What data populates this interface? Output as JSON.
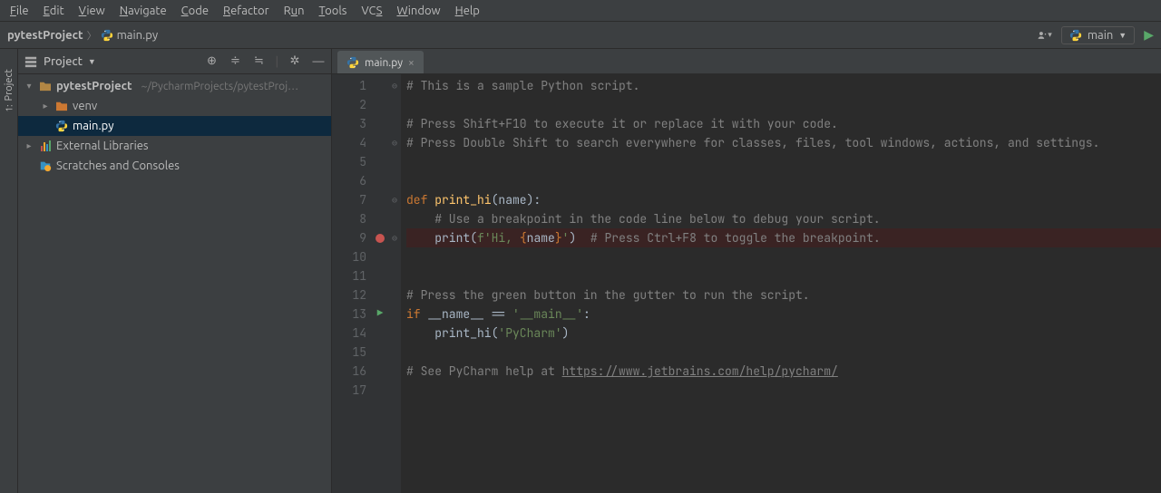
{
  "menu": {
    "file": "File",
    "edit": "Edit",
    "view": "View",
    "navigate": "Navigate",
    "code": "Code",
    "refactor": "Refactor",
    "run": "Run",
    "tools": "Tools",
    "vcs": "VCS",
    "window": "Window",
    "help": "Help"
  },
  "breadcrumb": {
    "project": "pytestProject",
    "file": "main.py"
  },
  "runConfig": {
    "label": "main"
  },
  "projectPanel": {
    "title": "Project",
    "root": {
      "name": "pytestProject",
      "path": "~/PycharmProjects/pytestProj…"
    },
    "venv": "venv",
    "mainFile": "main.py",
    "extLibs": "External Libraries",
    "scratches": "Scratches and Consoles"
  },
  "tab": {
    "label": "main.py"
  },
  "sideTab": {
    "label": "Project"
  },
  "code": {
    "lines": [
      "# This is a sample Python script.",
      "",
      "# Press Shift+F10 to execute it or replace it with your code.",
      "# Press Double Shift to search everywhere for classes, files, tool windows, actions, and settings.",
      "",
      "",
      "def print_hi(name):",
      "    # Use a breakpoint in the code line below to debug your script.",
      "    print(f'Hi, {name}')  # Press Ctrl+F8 to toggle the breakpoint.",
      "",
      "",
      "# Press the green button in the gutter to run the script.",
      "if __name__ == '__main__':",
      "    print_hi('PyCharm')",
      "",
      "# See PyCharm help at https://www.jetbrains.com/help/pycharm/",
      ""
    ],
    "url": "https://www.jetbrains.com/help/pycharm/"
  }
}
